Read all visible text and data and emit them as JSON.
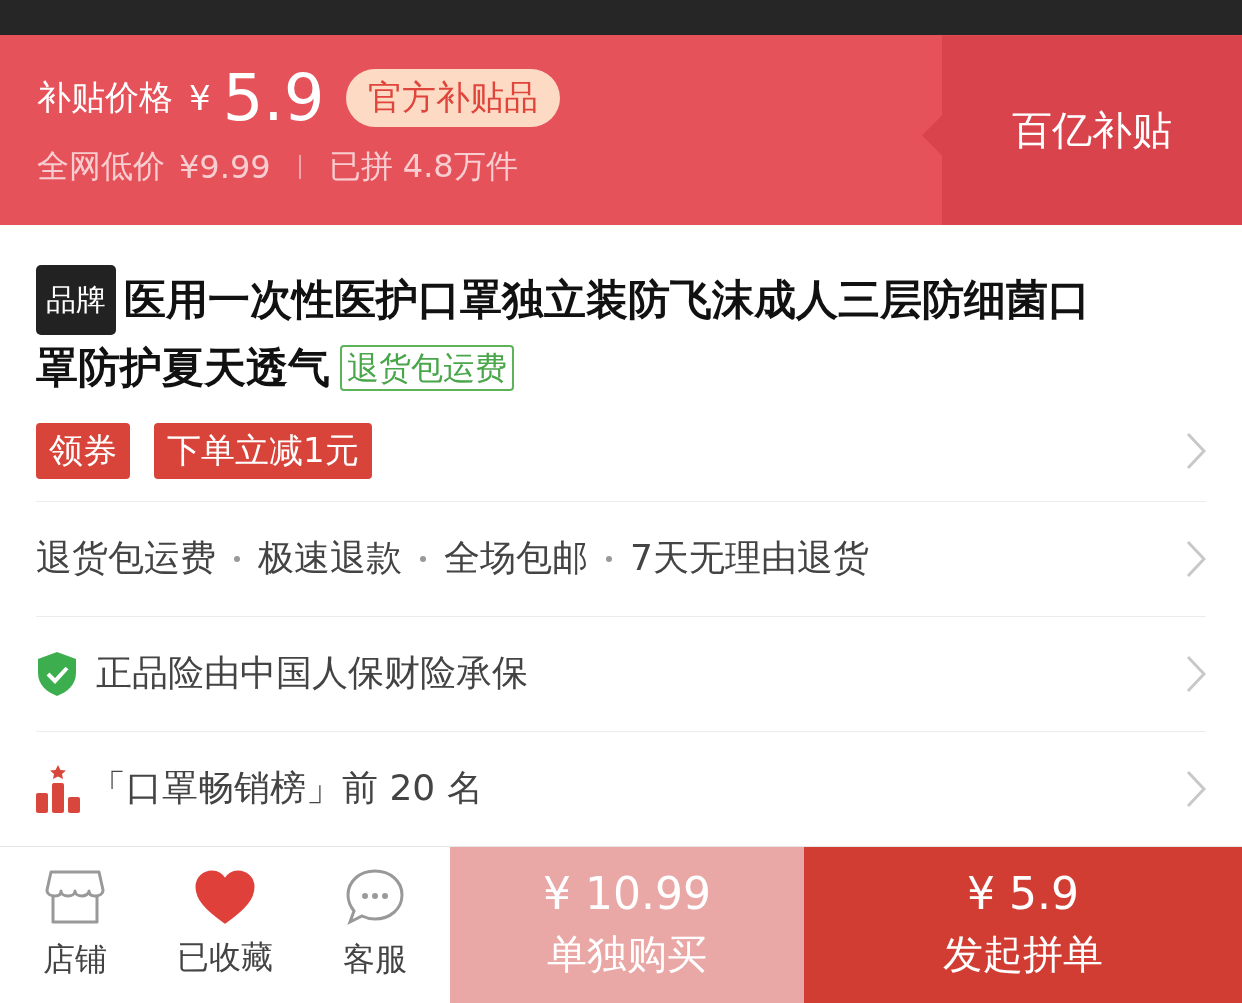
{
  "price_banner": {
    "label": "补贴价格",
    "currency": "¥",
    "price": "5.9",
    "badge": "官方补贴品",
    "compare_label": "全网低价",
    "compare_price": "¥9.99",
    "sold": "已拼 4.8万件",
    "side_label": "百亿补贴"
  },
  "product": {
    "brand_tag": "品牌",
    "title": "医用一次性医护口罩独立装防飞沫成人三层防细菌口罩防护夏天透气",
    "return_tag": "退货包运费"
  },
  "rows": [
    {
      "kind": "coupons",
      "tags": [
        "领券",
        "下单立减1元"
      ]
    },
    {
      "kind": "services",
      "items": [
        "退货包运费",
        "极速退款",
        "全场包邮",
        "7天无理由退货"
      ]
    },
    {
      "kind": "insurance",
      "text": "正品险由中国人保财险承保"
    },
    {
      "kind": "ranking",
      "text": "「口罩畅销榜」前 20 名"
    }
  ],
  "bottom_bar": {
    "shop": {
      "label": "店铺"
    },
    "favorite": {
      "label": "已收藏",
      "on": true
    },
    "service": {
      "label": "客服"
    },
    "buttons": [
      {
        "kind": "solo",
        "price": "¥ 10.99",
        "label": "单独购买"
      },
      {
        "kind": "group",
        "price": "¥ 5.9",
        "label": "发起拼单"
      }
    ]
  }
}
